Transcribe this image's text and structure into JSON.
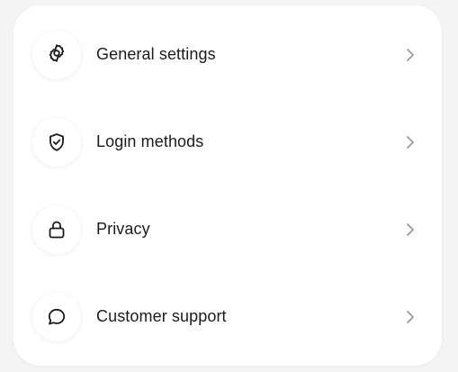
{
  "colors": {
    "background": "#f4f4f5",
    "card": "#ffffff",
    "text": "#1b1b1f",
    "icon": "#1b1b1f",
    "chevron": "#9a9aa0"
  },
  "menu": {
    "items": [
      {
        "label": "General settings",
        "icon": "gear-icon"
      },
      {
        "label": "Login methods",
        "icon": "shield-check-icon"
      },
      {
        "label": "Privacy",
        "icon": "lock-icon"
      },
      {
        "label": "Customer support",
        "icon": "chat-bubble-icon"
      }
    ]
  }
}
